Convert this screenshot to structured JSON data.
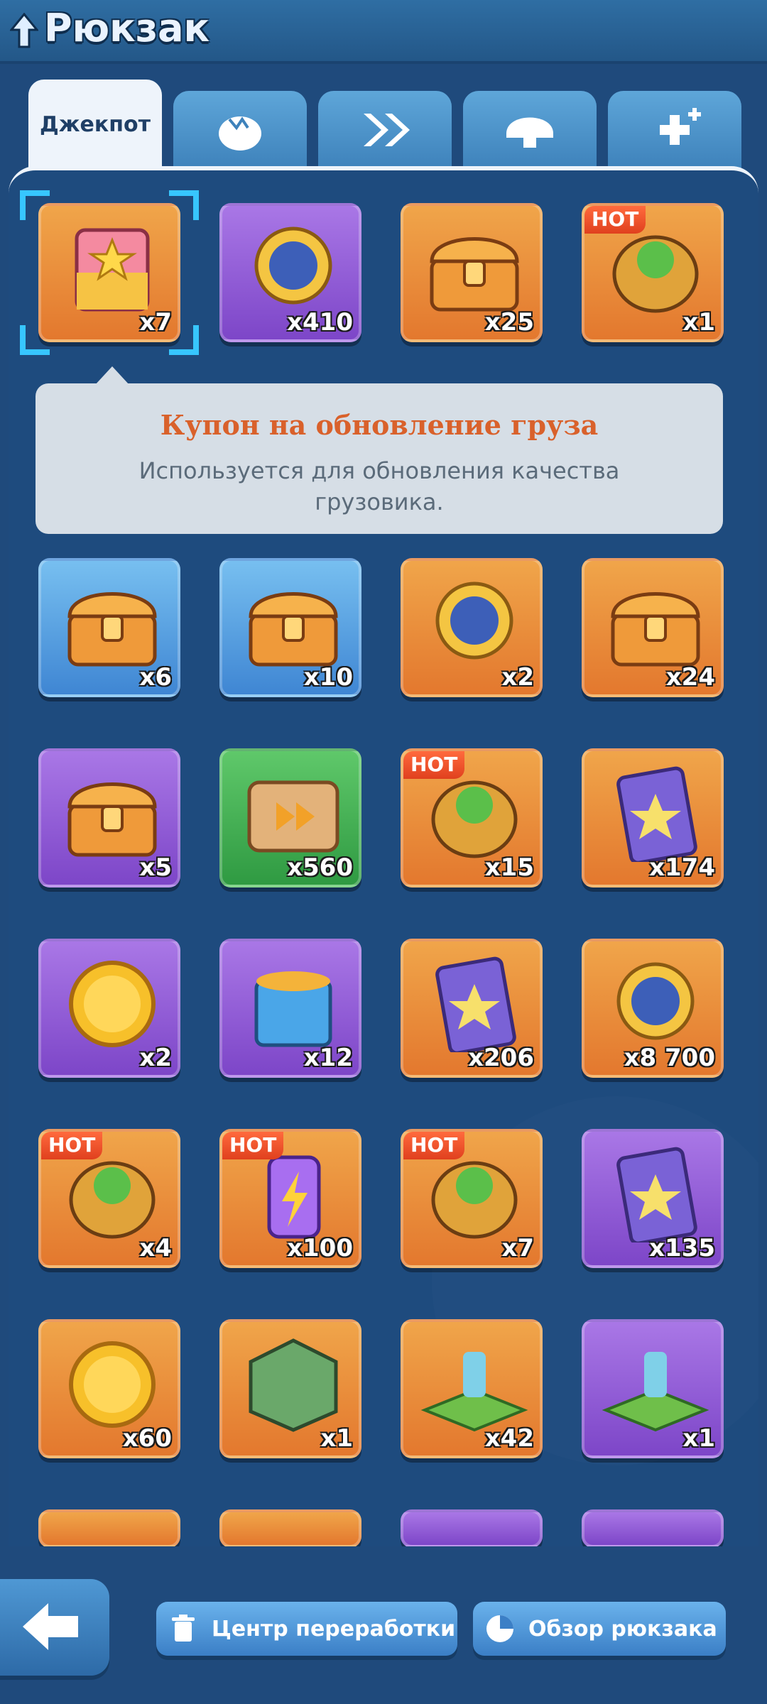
{
  "header": {
    "title": "Рюкзак",
    "up_icon": "arrow-up-icon"
  },
  "tabs": [
    {
      "label": "Джекпот",
      "active": true
    },
    {
      "icon": "egg-icon"
    },
    {
      "icon": "double-chevron-icon"
    },
    {
      "icon": "helmet-icon"
    },
    {
      "icon": "plus-icon"
    }
  ],
  "tooltip": {
    "title": "Купон на обновление груза",
    "description": "Используется для обновления качества грузовика."
  },
  "items": [
    {
      "count": "x7",
      "bg": "orange",
      "icon": "coupon-ticket-icon",
      "hot": "",
      "selected": true
    },
    {
      "count": "x410",
      "bg": "purple",
      "icon": "vs-medal-icon",
      "hot": ""
    },
    {
      "count": "x25",
      "bg": "orange",
      "icon": "chest-icon",
      "hot": ""
    },
    {
      "count": "x1",
      "bg": "orange",
      "icon": "armor-suit-icon",
      "hot": "HOT"
    },
    {
      "count": "x6",
      "bg": "blue",
      "icon": "chest-icon",
      "hot": ""
    },
    {
      "count": "x10",
      "bg": "blue",
      "icon": "chest-icon",
      "hot": ""
    },
    {
      "count": "x2",
      "bg": "orange",
      "icon": "crown-badge-icon",
      "hot": ""
    },
    {
      "count": "x24",
      "bg": "orange",
      "icon": "chest-cards-icon",
      "hot": ""
    },
    {
      "count": "x5",
      "bg": "purple",
      "icon": "chest-icon",
      "hot": ""
    },
    {
      "count": "x560",
      "bg": "green",
      "icon": "speedup-box-icon",
      "hot": ""
    },
    {
      "count": "x15",
      "bg": "orange",
      "icon": "armor-puzzle-icon",
      "hot": "HOT"
    },
    {
      "count": "x174",
      "bg": "orange",
      "icon": "star-card-icon",
      "hot": ""
    },
    {
      "count": "x2",
      "bg": "purple",
      "icon": "gamepad-coin-icon",
      "hot": ""
    },
    {
      "count": "x12",
      "bg": "purple",
      "icon": "fish-can-icon",
      "hot": ""
    },
    {
      "count": "x206",
      "bg": "orange",
      "icon": "star-card-icon",
      "hot": ""
    },
    {
      "count": "x8 700",
      "bg": "orange",
      "icon": "helmet-medal-icon",
      "hot": ""
    },
    {
      "count": "x4",
      "bg": "orange",
      "icon": "frog-puzzle-icon",
      "hot": "HOT"
    },
    {
      "count": "x100",
      "bg": "orange",
      "icon": "energy-battery-icon",
      "hot": "HOT"
    },
    {
      "count": "x7",
      "bg": "orange",
      "icon": "frog-puzzle-icon",
      "hot": "HOT"
    },
    {
      "count": "x135",
      "bg": "purple",
      "icon": "star-card-icon",
      "hot": ""
    },
    {
      "count": "x60",
      "bg": "orange",
      "icon": "coin-stack-icon",
      "hot": ""
    },
    {
      "count": "x1",
      "bg": "orange",
      "icon": "portrait-badge-icon",
      "hot": ""
    },
    {
      "count": "x42",
      "bg": "orange",
      "icon": "turret-island-icon",
      "hot": ""
    },
    {
      "count": "x1",
      "bg": "purple",
      "icon": "statue-island-icon",
      "hot": ""
    },
    {
      "count": "",
      "bg": "orange",
      "icon": "partial-item-icon",
      "hot": ""
    },
    {
      "count": "",
      "bg": "orange",
      "icon": "partial-item-icon",
      "hot": ""
    },
    {
      "count": "",
      "bg": "purple",
      "icon": "partial-item-icon",
      "hot": ""
    },
    {
      "count": "",
      "bg": "purple",
      "icon": "partial-item-icon",
      "hot": ""
    }
  ],
  "bottom_bar": {
    "back_icon": "back-arrow-icon",
    "recycle_label": "Центр переработки",
    "recycle_icon": "trash-icon",
    "overview_label": "Обзор рюкзака",
    "overview_icon": "pie-chart-icon"
  }
}
